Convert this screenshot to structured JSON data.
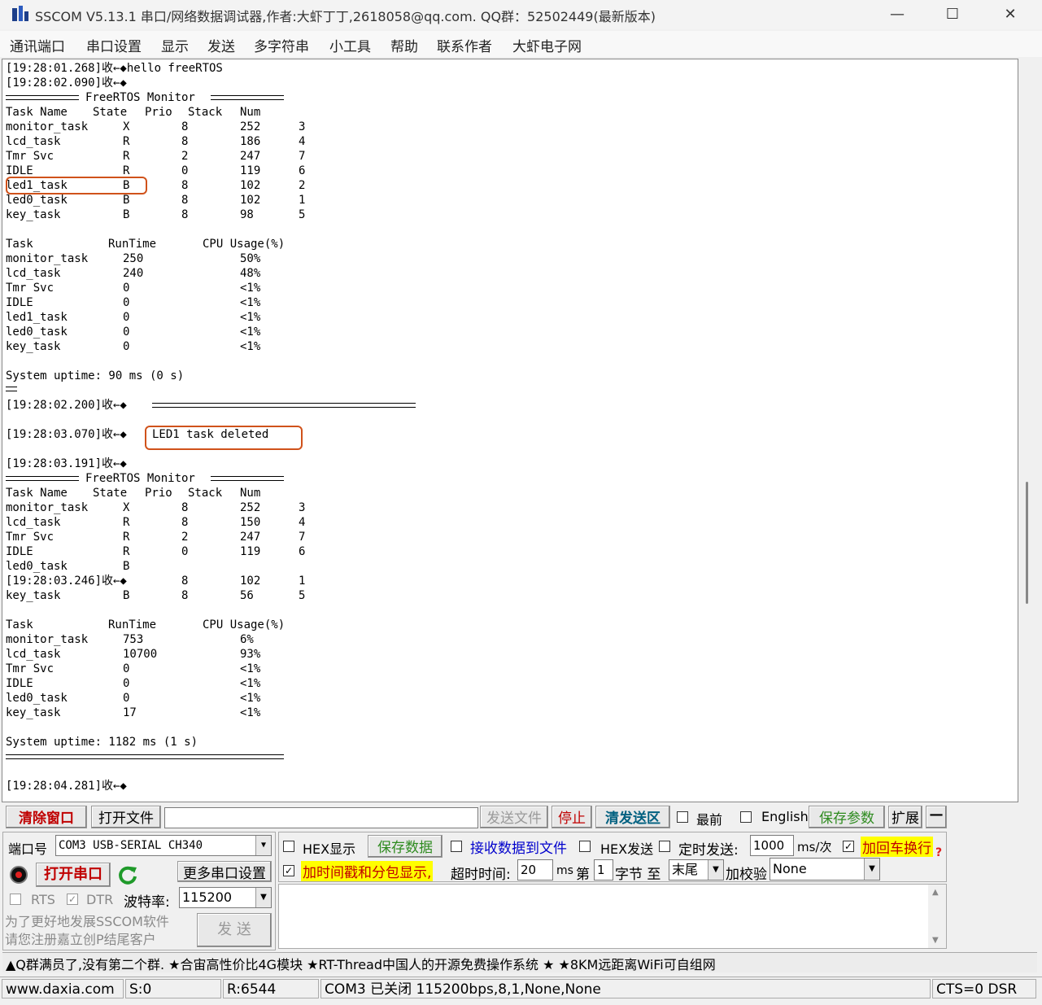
{
  "window": {
    "title": "SSCOM V5.13.1 串口/网络数据调试器,作者:大虾丁丁,2618058@qq.com. QQ群：52502449(最新版本)",
    "minimize": "—",
    "maximize": "☐",
    "close": "✕"
  },
  "menu": [
    "通讯端口",
    "串口设置",
    "显示",
    "发送",
    "多字符串",
    "小工具",
    "帮助",
    "联系作者",
    "大虾电子网"
  ],
  "terminal": {
    "rx1": "[19:28:01.268]收←◆hello freeRTOS",
    "rx2": "[19:28:02.090]收←◆",
    "monitor_title": "FreeRTOS Monitor",
    "task_header": [
      "Task Name",
      "State",
      "Prio",
      "Stack",
      "Num"
    ],
    "tasks1": [
      [
        "monitor_task",
        "X",
        "8",
        "252",
        "3"
      ],
      [
        "lcd_task",
        "R",
        "8",
        "186",
        "4"
      ],
      [
        "Tmr Svc",
        "R",
        "2",
        "247",
        "7"
      ],
      [
        "IDLE",
        "R",
        "0",
        "119",
        "6"
      ],
      [
        "led1_task",
        "B",
        "8",
        "102",
        "2"
      ],
      [
        "led0_task",
        "B",
        "8",
        "102",
        "1"
      ],
      [
        "key_task",
        "B",
        "8",
        "98",
        "5"
      ]
    ],
    "rt_header": [
      "Task",
      "RunTime",
      "CPU Usage(%)"
    ],
    "runtime1": [
      [
        "monitor_task",
        "250",
        "50%"
      ],
      [
        "lcd_task",
        "240",
        "48%"
      ],
      [
        "Tmr Svc",
        "0",
        "<1%"
      ],
      [
        "IDLE",
        "0",
        "<1%"
      ],
      [
        "led1_task",
        "0",
        "<1%"
      ],
      [
        "led0_task",
        "0",
        "<1%"
      ],
      [
        "key_task",
        "0",
        "<1%"
      ]
    ],
    "uptime1": "System uptime: 90 ms (0 s)",
    "rx3": "[19:28:02.200]收←◆",
    "rx4": "[19:28:03.070]收←◆",
    "deleted_msg": "LED1 task deleted",
    "rx5": "[19:28:03.191]收←◆",
    "tasks2": [
      [
        "monitor_task",
        "X",
        "8",
        "252",
        "3"
      ],
      [
        "lcd_task",
        "R",
        "8",
        "150",
        "4"
      ],
      [
        "Tmr Svc",
        "R",
        "2",
        "247",
        "7"
      ],
      [
        "IDLE",
        "R",
        "0",
        "119",
        "6"
      ]
    ],
    "led0_row": [
      "led0_task",
      "B"
    ],
    "rx6": "[19:28:03.246]收←◆",
    "rx6_cont": [
      "8",
      "102",
      "1"
    ],
    "key_row2": [
      "key_task",
      "B",
      "8",
      "56",
      "5"
    ],
    "runtime2": [
      [
        "monitor_task",
        "753",
        "6%"
      ],
      [
        "lcd_task",
        "10700",
        "93%"
      ],
      [
        "Tmr Svc",
        "0",
        "<1%"
      ],
      [
        "IDLE",
        "0",
        "<1%"
      ],
      [
        "led0_task",
        "0",
        "<1%"
      ],
      [
        "key_task",
        "17",
        "<1%"
      ]
    ],
    "uptime2": "System uptime: 1182 ms (1 s)",
    "rx7": "[19:28:04.281]收←◆"
  },
  "toolbar": {
    "clear": "清除窗口",
    "open_file": "打开文件",
    "send_file": "发送文件",
    "stop": "停止",
    "clear_send": "清发送区",
    "topmost": "最前",
    "english": "English",
    "save_params": "保存参数",
    "expand": "扩展",
    "collapse": "—"
  },
  "port": {
    "port_label": "端口号",
    "port_value": "COM3 USB-SERIAL CH340",
    "more_settings": "更多串口设置",
    "open_port": "打开串口",
    "rts": "RTS",
    "dtr": "DTR",
    "baud_label": "波特率:",
    "baud_value": "115200",
    "promo": "为了更好地发展SSCOM软件\n请您注册嘉立创P结尾客户",
    "send": "发 送"
  },
  "options": {
    "hex_display": "HEX显示",
    "save_data": "保存数据",
    "recv_to_file": "接收数据到文件",
    "hex_send": "HEX发送",
    "timed_send": "定时发送:",
    "interval": "1000",
    "interval_unit": "ms/次",
    "add_crlf": "加回车换行",
    "timestamp": "加时间戳和分包显示,",
    "timeout_label": "超时时间:",
    "timeout_value": "20",
    "timeout_unit": "ms",
    "byte_from_label": "第",
    "byte_from": "1",
    "byte_to_label": "字节 至",
    "byte_to": "末尾",
    "checksum_label": "加校验",
    "checksum": "None"
  },
  "ticker": "▲Q群满员了,没有第二个群. ★合宙高性价比4G模块 ★RT-Thread中国人的开源免费操作系统 ★ ★8KM远距离WiFi可自组网",
  "status": {
    "site": "www.daxia.com",
    "sent": "S:0",
    "recv": "R:6544",
    "port_state": "COM3 已关闭  115200bps,8,1,None,None",
    "cts": "CTS=0 DSR"
  }
}
